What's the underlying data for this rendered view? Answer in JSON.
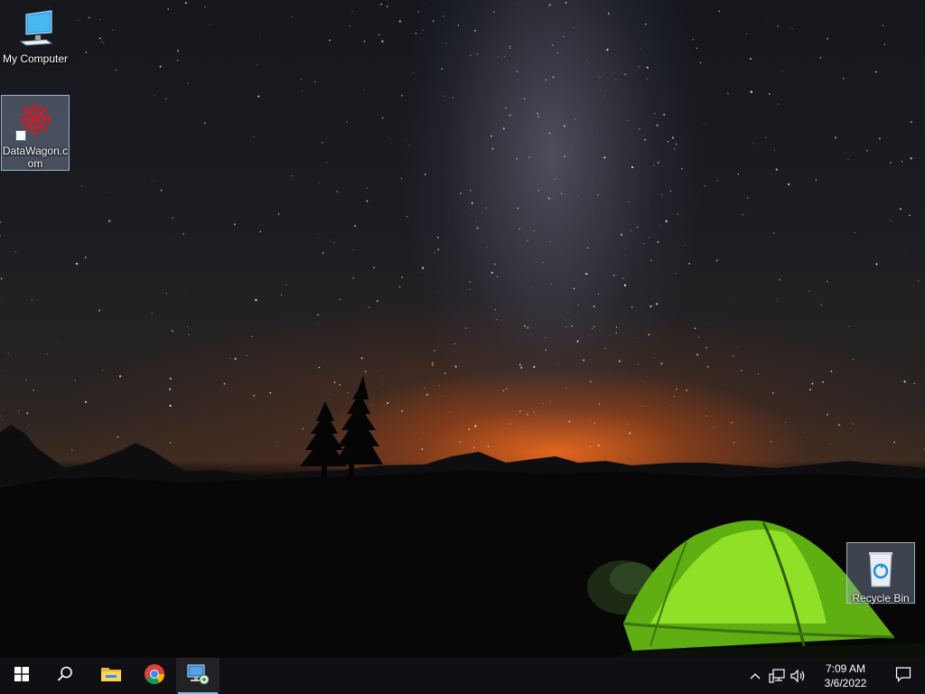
{
  "desktop": {
    "icons": [
      {
        "label": "My Computer",
        "icon": "monitor-icon"
      },
      {
        "label": "DataWagon.com",
        "icon": "datawagon-logo-icon"
      },
      {
        "label": "Recycle Bin",
        "icon": "recycle-bin-icon"
      }
    ]
  },
  "taskbar": {
    "items": [
      {
        "name": "Start",
        "icon": "windows-logo-icon"
      },
      {
        "name": "Search",
        "icon": "search-icon"
      },
      {
        "name": "File Explorer",
        "icon": "folder-icon"
      },
      {
        "name": "Google Chrome",
        "icon": "chrome-icon"
      },
      {
        "name": "Remote Desktop Connection",
        "icon": "remote-desktop-icon"
      }
    ],
    "tray": {
      "icons": [
        "chevron-up-icon",
        "network-icon",
        "volume-icon"
      ],
      "time": "7:09 AM",
      "date": "3/6/2022",
      "action_center_icon": "notification-icon"
    }
  },
  "colors": {
    "taskbar_bg": "#101014",
    "active_indicator": "#76b9ed",
    "tent_green": "#7cd61e"
  }
}
